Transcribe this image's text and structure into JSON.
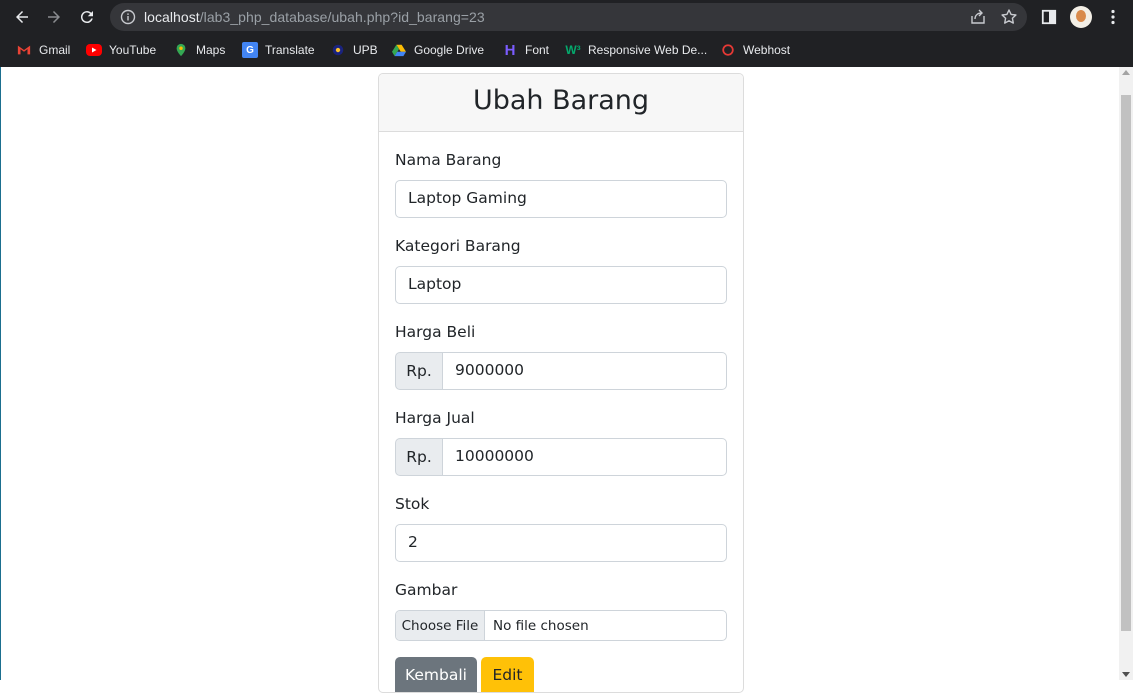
{
  "browser": {
    "url_host": "localhost",
    "url_path": "/lab3_php_database/ubah.php?id_barang=23",
    "bookmarks": [
      {
        "label": "Gmail",
        "icon": "gmail-icon"
      },
      {
        "label": "YouTube",
        "icon": "youtube-icon"
      },
      {
        "label": "Maps",
        "icon": "maps-icon"
      },
      {
        "label": "Translate",
        "icon": "translate-icon"
      },
      {
        "label": "UPB",
        "icon": "upb-icon"
      },
      {
        "label": "Google Drive",
        "icon": "google-drive-icon"
      },
      {
        "label": "Font",
        "icon": "font-icon"
      },
      {
        "label": "Responsive Web De...",
        "icon": "w3-icon"
      },
      {
        "label": "Webhost",
        "icon": "webhost-icon"
      }
    ]
  },
  "form": {
    "title": "Ubah Barang",
    "nama_label": "Nama Barang",
    "nama_value": "Laptop Gaming",
    "kategori_label": "Kategori Barang",
    "kategori_value": "Laptop",
    "harga_beli_label": "Harga Beli",
    "harga_beli_prefix": "Rp.",
    "harga_beli_value": "9000000",
    "harga_jual_label": "Harga Jual",
    "harga_jual_prefix": "Rp.",
    "harga_jual_value": "10000000",
    "stok_label": "Stok",
    "stok_value": "2",
    "gambar_label": "Gambar",
    "file_button": "Choose File",
    "file_status": "No file chosen",
    "back_button": "Kembali",
    "edit_button": "Edit"
  },
  "colors": {
    "chrome_bg": "#202124",
    "btn_secondary": "#6c757d",
    "btn_warning": "#ffc107"
  }
}
